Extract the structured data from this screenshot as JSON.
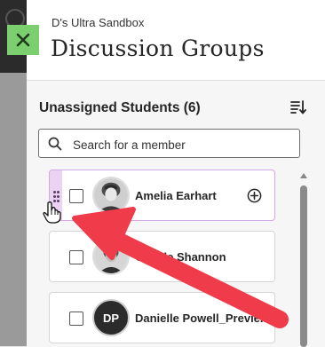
{
  "header": {
    "course_name": "D's Ultra Sandbox",
    "title": "Discussion Groups"
  },
  "panel": {
    "section_title": "Unassigned Students (6)",
    "search": {
      "placeholder": "Search for a member",
      "value": ""
    },
    "students": [
      {
        "name": "Amelia Earhart",
        "avatar": "photo",
        "active": true
      },
      {
        "name": "Claude Shannon",
        "avatar": "photo"
      },
      {
        "name": "Danielle Powell_Previe...",
        "avatar": "initials",
        "initials": "DP"
      }
    ]
  },
  "colors": {
    "close_button": "#7ccf6f",
    "grip_highlight": "#ecd3f4",
    "arrow": "#ef3b4a"
  },
  "icons": [
    "close-icon",
    "sort-icon",
    "search-icon",
    "drag-handle-icon",
    "add-icon",
    "hand-cursor-icon"
  ]
}
